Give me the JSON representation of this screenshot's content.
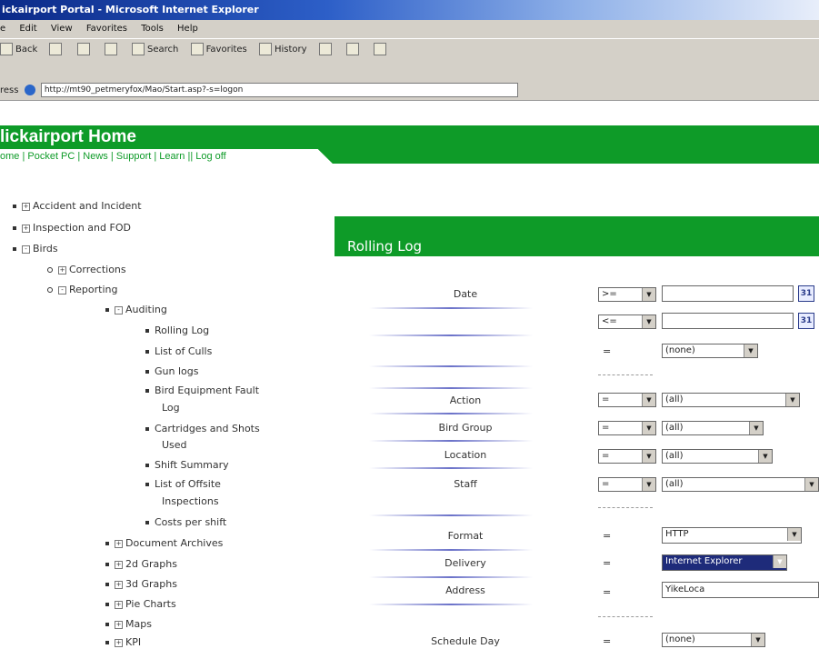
{
  "window": {
    "title": "ickairport Portal - Microsoft Internet Explorer"
  },
  "menu": [
    "e",
    "Edit",
    "View",
    "Favorites",
    "Tools",
    "Help"
  ],
  "toolbar": {
    "back": "Back",
    "search": "Search",
    "favorites": "Favorites",
    "history": "History"
  },
  "address": {
    "label": "ress",
    "url": "http://mt90_petmeryfox/Mao/Start.asp?-s=logon"
  },
  "header": {
    "title": "lickairport Home",
    "nav": "ome | Pocket PC | News | Support | Learn || Log off"
  },
  "tree": [
    {
      "label": "Accident and Incident",
      "expander": "+"
    },
    {
      "label": "Inspection and FOD",
      "expander": "+"
    },
    {
      "label": "Birds",
      "expander": "-"
    },
    {
      "label": "Corrections",
      "expander": "+"
    },
    {
      "label": "Reporting",
      "expander": "-"
    },
    {
      "label": "Auditing",
      "expander": "-"
    },
    {
      "label": "Rolling Log"
    },
    {
      "label": "List of Culls"
    },
    {
      "label": "Gun logs"
    },
    {
      "label": "Bird Equipment Fault"
    },
    {
      "label": "Log"
    },
    {
      "label": "Cartridges and Shots"
    },
    {
      "label": "Used"
    },
    {
      "label": "Shift Summary"
    },
    {
      "label": "List of Offsite"
    },
    {
      "label": "Inspections"
    },
    {
      "label": "Costs per shift"
    },
    {
      "label": "Document Archives",
      "expander": "+"
    },
    {
      "label": "2d Graphs",
      "expander": "+"
    },
    {
      "label": "3d Graphs",
      "expander": "+"
    },
    {
      "label": "Pie Charts",
      "expander": "+"
    },
    {
      "label": "Maps",
      "expander": "+"
    },
    {
      "label": "KPI",
      "expander": "+"
    }
  ],
  "form": {
    "title": "Rolling Log",
    "date_label": "Date",
    "op_ge": ">=",
    "op_le": "<=",
    "op_eq": "=",
    "none": "(none)",
    "all": "(all)",
    "action_label": "Action",
    "bird_group_label": "Bird Group",
    "location_label": "Location",
    "staff_label": "Staff",
    "format_label": "Format",
    "format_value": "HTTP",
    "delivery_label": "Delivery",
    "delivery_value": "Internet Explorer",
    "address_label": "Address",
    "address_value": "YikeLoca",
    "schedule_label": "Schedule Day",
    "calendar_glyph": "31"
  }
}
